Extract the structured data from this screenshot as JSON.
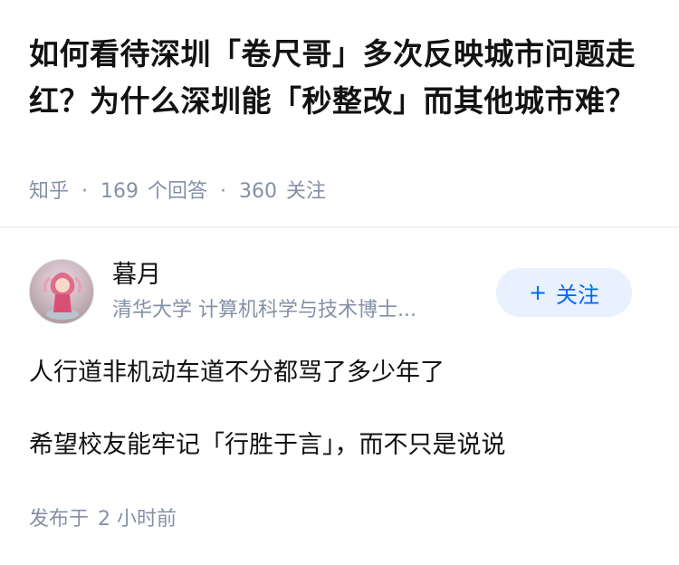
{
  "question": {
    "title": "如何看待深圳「卷尺哥」多次反映城市问题走红？为什么深圳能「秒整改」而其他城市难？",
    "source": "知乎",
    "answer_count": "169",
    "answer_label": "个回答",
    "follower_count": "360",
    "follower_label": "关注"
  },
  "author": {
    "name": "暮月",
    "bio": "清华大学 计算机科学与技术博士...",
    "follow_label": "关注",
    "follow_icon": "plus-icon"
  },
  "answer": {
    "paragraphs": [
      "人行道非机动车道不分都骂了多少年了",
      "希望校友能牢记「行胜于言」，而不只是说说"
    ]
  },
  "posted": {
    "label": "发布于",
    "time": "2 小时前"
  },
  "colors": {
    "accent": "#0066ff",
    "follow_bg": "#e8f1fd",
    "meta": "#8590a6",
    "text": "#121212"
  }
}
